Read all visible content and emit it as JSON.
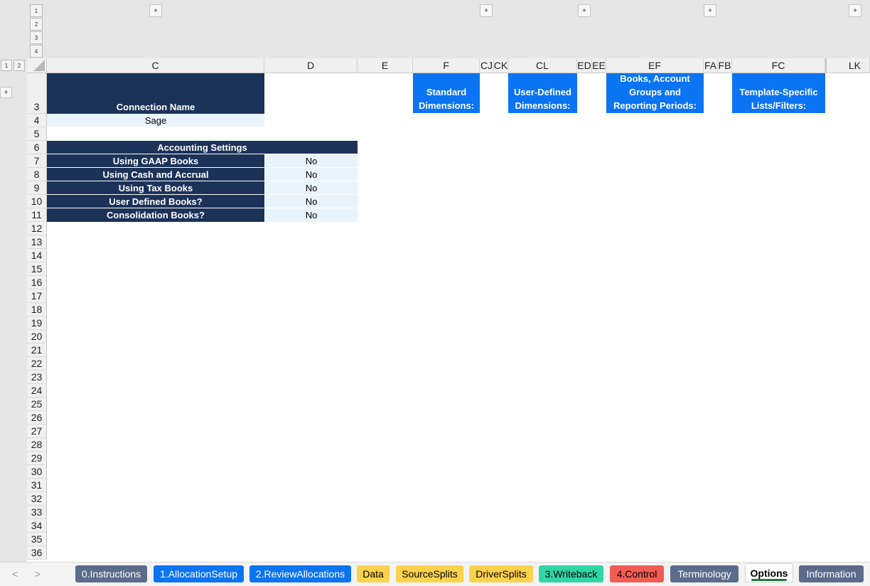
{
  "outline": {
    "levels": [
      "1",
      "2",
      "3",
      "4"
    ],
    "row_levels": [
      "1",
      "2"
    ],
    "expand_glyph": "+"
  },
  "columns": [
    "C",
    "D",
    "E",
    "F",
    "CJ",
    "CK",
    "CL",
    "ED",
    "EE",
    "EF",
    "FA",
    "FB",
    "FC",
    "LK"
  ],
  "rows": [
    "3",
    "4",
    "5",
    "6",
    "7",
    "8",
    "9",
    "10",
    "11",
    "12",
    "13",
    "14",
    "15",
    "16",
    "17",
    "18",
    "19",
    "20",
    "21",
    "22",
    "23",
    "24",
    "25",
    "26",
    "27",
    "28",
    "29",
    "30",
    "31",
    "32",
    "33",
    "34",
    "35",
    "36"
  ],
  "sheet": {
    "connection_name_label": "Connection Name",
    "connection_name_value": "Sage",
    "accounting_header": "Accounting Settings",
    "settings": [
      {
        "label": "Using GAAP Books",
        "value": "No"
      },
      {
        "label": "Using Cash and Accrual",
        "value": "No"
      },
      {
        "label": "Using Tax Books",
        "value": "No"
      },
      {
        "label": "User Defined Books?",
        "value": "No"
      },
      {
        "label": "Consolidation Books?",
        "value": "No"
      }
    ],
    "section_headers": {
      "standard": [
        "Standard",
        "Dimensions:"
      ],
      "user_defined": [
        "User-Defined",
        "Dimensions:"
      ],
      "books": [
        "Books, Account",
        "Groups and",
        "Reporting Periods:"
      ],
      "template": [
        "Template-Specific",
        "Lists/Filters:"
      ]
    }
  },
  "tabs": [
    {
      "label": "0.Instructions",
      "color": "#5b6b8c",
      "text_color": "#ffffff"
    },
    {
      "label": "1.AllocationSetup",
      "color": "#0b74f2",
      "text_color": "#ffffff"
    },
    {
      "label": "2.ReviewAllocations",
      "color": "#0b74f2",
      "text_color": "#ffffff"
    },
    {
      "label": "Data",
      "color": "#ffd24d",
      "text_color": "#000000"
    },
    {
      "label": "SourceSplits",
      "color": "#ffd24d",
      "text_color": "#000000"
    },
    {
      "label": "DriverSplits",
      "color": "#ffd24d",
      "text_color": "#000000"
    },
    {
      "label": "3.Writeback",
      "color": "#2fd6a4",
      "text_color": "#000000"
    },
    {
      "label": "4.Control",
      "color": "#f25c54",
      "text_color": "#000000"
    },
    {
      "label": "Terminology",
      "color": "#5b6b8c",
      "text_color": "#ffffff"
    },
    {
      "label": "Options",
      "color": "#ffffff",
      "text_color": "#000000",
      "active": true
    },
    {
      "label": "Information",
      "color": "#5b6b8c",
      "text_color": "#ffffff"
    }
  ],
  "nav": {
    "prev": "<",
    "next": ">"
  },
  "colors": {
    "navy": "#1c3258",
    "light_cell": "#e8f4fd",
    "bright_blue": "#0b74f2",
    "active_tab_underline": "#217346"
  }
}
